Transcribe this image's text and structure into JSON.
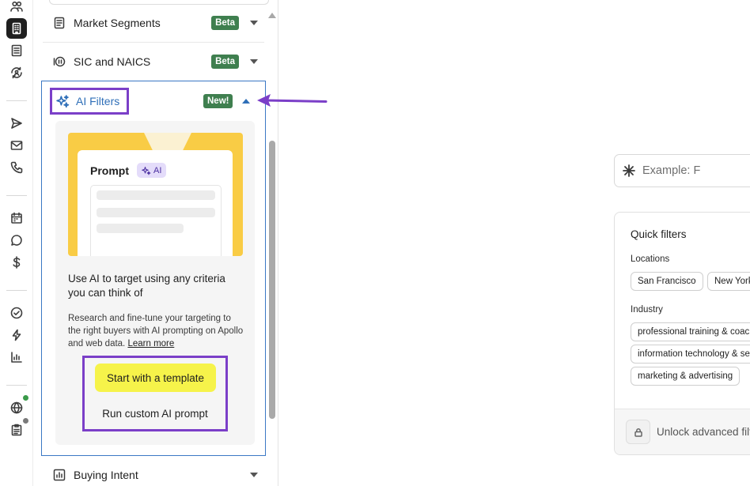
{
  "filters": {
    "market_segments": {
      "label": "Market Segments",
      "badge": "Beta"
    },
    "sic_naics": {
      "label": "SIC and NAICS",
      "badge": "Beta"
    },
    "ai_filters": {
      "label": "AI Filters",
      "badge": "New!"
    },
    "buying_intent": {
      "label": "Buying Intent"
    }
  },
  "ai_card": {
    "prompt_title": "Prompt",
    "ai_pill": "AI",
    "heading": "Use AI to target using any criteria you can think of",
    "description": "Research and fine-tune your targeting to the right buyers with AI prompting on Apollo and web data.",
    "learn_more": "Learn more",
    "start_template": "Start with a template",
    "run_custom": "Run custom AI prompt"
  },
  "search": {
    "placeholder": "Example: F"
  },
  "quick_filters": {
    "title": "Quick filters",
    "locations_label": "Locations",
    "locations": [
      "San Francisco",
      "New York"
    ],
    "industry_label": "Industry",
    "industries": [
      "professional training & coaching",
      "information technology & services",
      "marketing & advertising"
    ],
    "unlock_text": "Unlock advanced filters"
  },
  "colors": {
    "accent_purple": "#7b3fc8",
    "beta_green": "#3f7f4f",
    "ai_blue": "#2f6fb8",
    "cta_yellow": "#f6f34a",
    "illustration_yellow": "#f9cc45"
  },
  "rail_icons": [
    "people-icon",
    "building-icon",
    "list-icon",
    "refresh-person-icon",
    "send-icon",
    "mail-icon",
    "phone-icon",
    "calendar-icon",
    "chat-icon",
    "dollar-icon",
    "check-circle-icon",
    "lightning-icon",
    "bar-chart-icon",
    "globe-icon",
    "clipboard-icon"
  ]
}
